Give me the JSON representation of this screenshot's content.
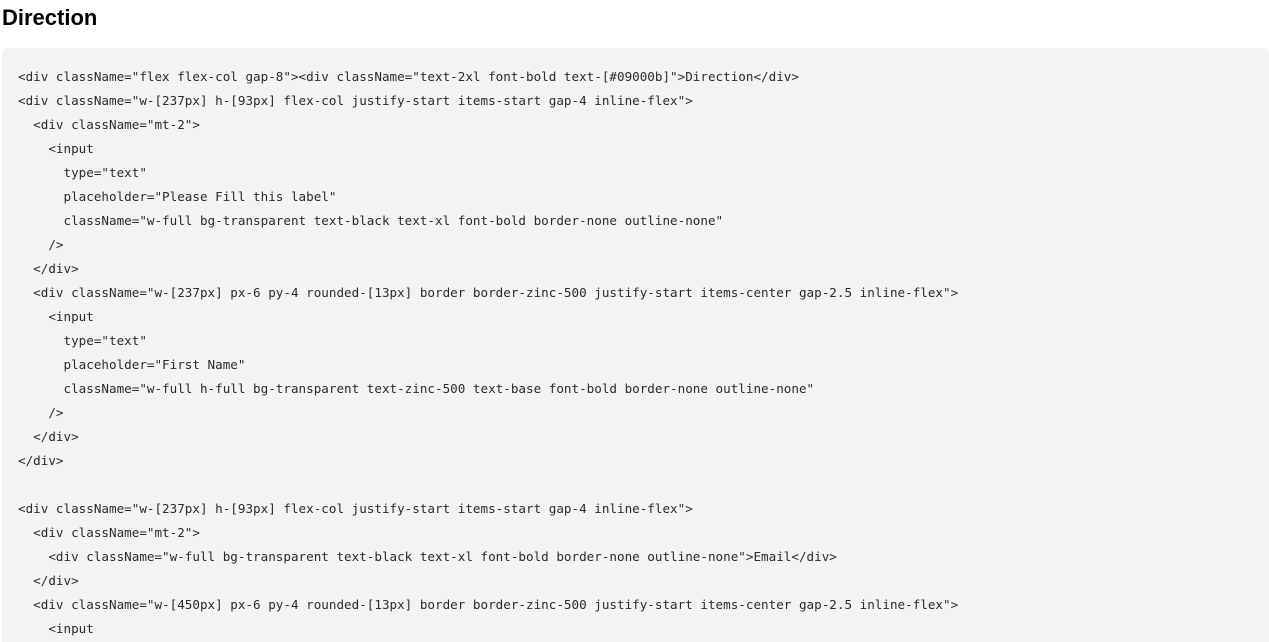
{
  "page": {
    "title": "Direction"
  },
  "code": {
    "lines": [
      "<div className=\"flex flex-col gap-8\"><div className=\"text-2xl font-bold text-[#09000b]\">Direction</div>",
      "<div className=\"w-[237px] h-[93px] flex-col justify-start items-start gap-4 inline-flex\">",
      "  <div className=\"mt-2\">",
      "    <input",
      "      type=\"text\"",
      "      placeholder=\"Please Fill this label\"",
      "      className=\"w-full bg-transparent text-black text-xl font-bold border-none outline-none\"",
      "    />",
      "  </div>",
      "  <div className=\"w-[237px] px-6 py-4 rounded-[13px] border border-zinc-500 justify-start items-center gap-2.5 inline-flex\">",
      "    <input",
      "      type=\"text\"",
      "      placeholder=\"First Name\"",
      "      className=\"w-full h-full bg-transparent text-zinc-500 text-base font-bold border-none outline-none\"",
      "    />",
      "  </div>",
      "</div>",
      "",
      "<div className=\"w-[237px] h-[93px] flex-col justify-start items-start gap-4 inline-flex\">",
      "  <div className=\"mt-2\">",
      "    <div className=\"w-full bg-transparent text-black text-xl font-bold border-none outline-none\">Email</div>",
      "  </div>",
      "  <div className=\"w-[450px] px-6 py-4 rounded-[13px] border border-zinc-500 justify-start items-center gap-2.5 inline-flex\">",
      "    <input"
    ]
  }
}
